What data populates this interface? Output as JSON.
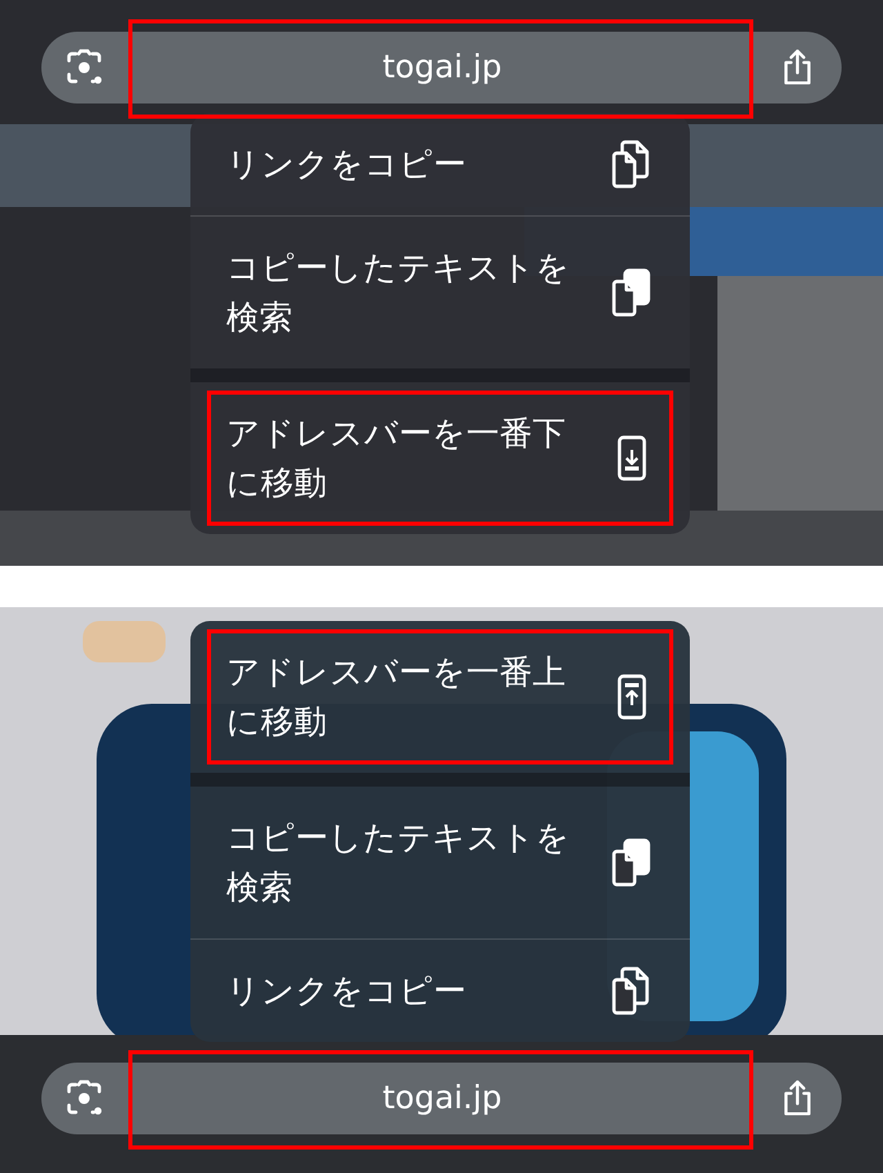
{
  "panels": [
    {
      "address_bar": {
        "url": "togai.jp",
        "highlighted": true
      },
      "menu": [
        {
          "label": "リンクをコピー",
          "kind": "copy",
          "new_group": false,
          "highlighted": false
        },
        {
          "label": "コピーしたテキストを検索",
          "kind": "paste",
          "new_group": false,
          "highlighted": false
        },
        {
          "label": "アドレスバーを一番下に移動",
          "kind": "move-down",
          "new_group": true,
          "highlighted": true
        }
      ]
    },
    {
      "address_bar": {
        "url": "togai.jp",
        "highlighted": true
      },
      "menu": [
        {
          "label": "アドレスバーを一番上に移動",
          "kind": "move-up",
          "new_group": false,
          "highlighted": true
        },
        {
          "label": "コピーしたテキストを検索",
          "kind": "paste",
          "new_group": true,
          "highlighted": false
        },
        {
          "label": "リンクをコピー",
          "kind": "copy",
          "new_group": false,
          "highlighted": false
        }
      ]
    }
  ]
}
